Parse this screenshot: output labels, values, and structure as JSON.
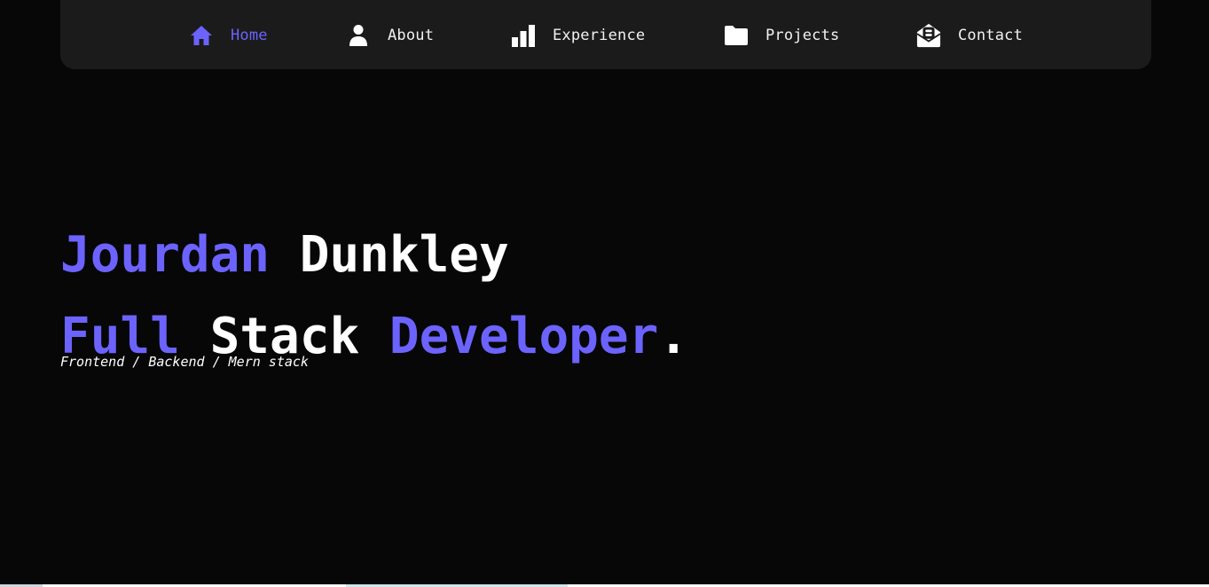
{
  "nav": {
    "items": [
      {
        "label": "Home",
        "icon": "home-icon",
        "active": true
      },
      {
        "label": "About",
        "icon": "person-icon",
        "active": false
      },
      {
        "label": "Experience",
        "icon": "bar-chart-icon",
        "active": false
      },
      {
        "label": "Projects",
        "icon": "folder-icon",
        "active": false
      },
      {
        "label": "Contact",
        "icon": "contact-mail-icon",
        "active": false
      }
    ]
  },
  "hero": {
    "first_name": "Jourdan",
    "last_name": "Dunkley",
    "role_word1": "Full",
    "role_word2": "Stack",
    "role_word3": "Developer",
    "role_period": ".",
    "subtitle": "Frontend / Backend / Mern stack"
  },
  "colors": {
    "accent": "#6c63ff",
    "background": "#070707",
    "navbar": "#1b1b1b",
    "text": "#ffffff"
  }
}
